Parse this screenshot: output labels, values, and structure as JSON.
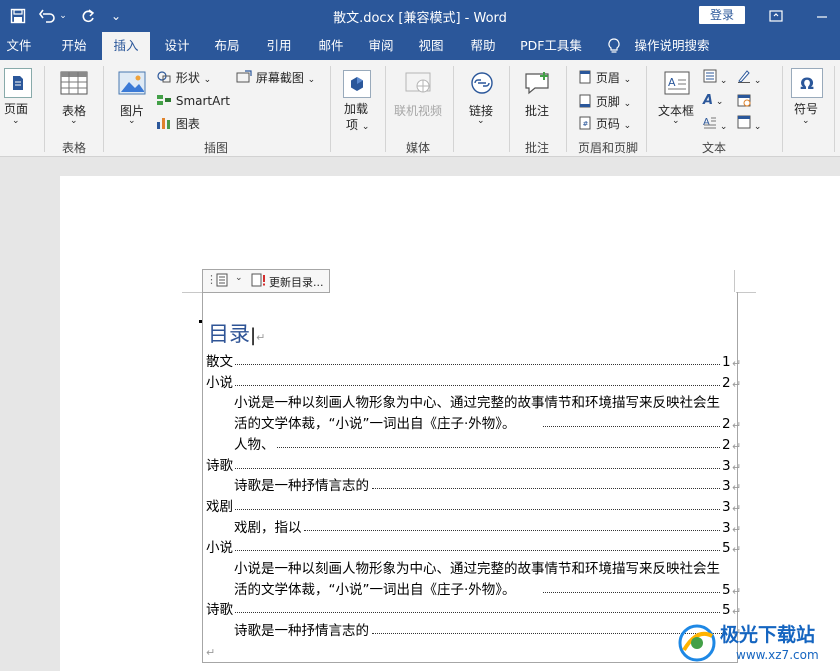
{
  "title_bar": {
    "document_title": "散文.docx [兼容模式]  -  Word",
    "login_label": "登录"
  },
  "menu": {
    "tabs": [
      {
        "label": "文件",
        "active": false
      },
      {
        "label": "开始",
        "active": false
      },
      {
        "label": "插入",
        "active": true
      },
      {
        "label": "设计",
        "active": false
      },
      {
        "label": "布局",
        "active": false
      },
      {
        "label": "引用",
        "active": false
      },
      {
        "label": "邮件",
        "active": false
      },
      {
        "label": "审阅",
        "active": false
      },
      {
        "label": "视图",
        "active": false
      },
      {
        "label": "帮助",
        "active": false
      },
      {
        "label": "PDF工具集",
        "active": false
      }
    ],
    "search_label": "操作说明搜索"
  },
  "ribbon": {
    "page_label": "页面",
    "table_label": "表格",
    "table_group": "表格",
    "picture_label": "图片",
    "shapes_label": "形状",
    "smartart_label": "SmartArt",
    "chart_label": "图表",
    "screenshot_label": "屏幕截图",
    "illustrations_group": "插图",
    "addins_label": "加载\n项",
    "online_video_label": "联机视频",
    "media_group": "媒体",
    "link_label": "链接",
    "comment_label": "批注",
    "comment_group": "批注",
    "header_label": "页眉",
    "footer_label": "页脚",
    "page_number_label": "页码",
    "header_footer_group": "页眉和页脚",
    "textbox_label": "文本框",
    "text_group": "文本",
    "symbol_label": "符号"
  },
  "toc": {
    "update_label": "更新目录...",
    "heading": "目录",
    "entries": [
      {
        "text": "散文",
        "page": "1",
        "level": 1
      },
      {
        "text": "小说",
        "page": "2",
        "level": 1
      },
      {
        "text": "小说是一种以刻画人物形象为中心、通过完整的故事情节和环境描写来反映社会生",
        "page": "",
        "level": 2
      },
      {
        "text": "活的文学体裁，“小说”一词出自《庄子·外物》。",
        "page": "2",
        "level": 2
      },
      {
        "text": "人物、",
        "page": "2",
        "level": 2
      },
      {
        "text": "诗歌",
        "page": "3",
        "level": 1
      },
      {
        "text": "诗歌是一种抒情言志的",
        "page": "3",
        "level": 2
      },
      {
        "text": "戏剧",
        "page": "3",
        "level": 1
      },
      {
        "text": "戏剧，指以",
        "page": "3",
        "level": 2
      },
      {
        "text": "小说",
        "page": "5",
        "level": 1
      },
      {
        "text": "小说是一种以刻画人物形象为中心、通过完整的故事情节和环境描写来反映社会生",
        "page": "",
        "level": 2
      },
      {
        "text": "活的文学体裁，“小说”一词出自《庄子·外物》。",
        "page": "5",
        "level": 2
      },
      {
        "text": "诗歌",
        "page": "5",
        "level": 1
      },
      {
        "text": "诗歌是一种抒情言志的",
        "page": "",
        "level": 2
      }
    ]
  },
  "watermark": {
    "brand": "极光下载站",
    "url": "www.xz7.com"
  },
  "colors": {
    "accent": "#2b579a",
    "heading": "#2f5496",
    "ribbon_bg": "#f3f3f3"
  }
}
